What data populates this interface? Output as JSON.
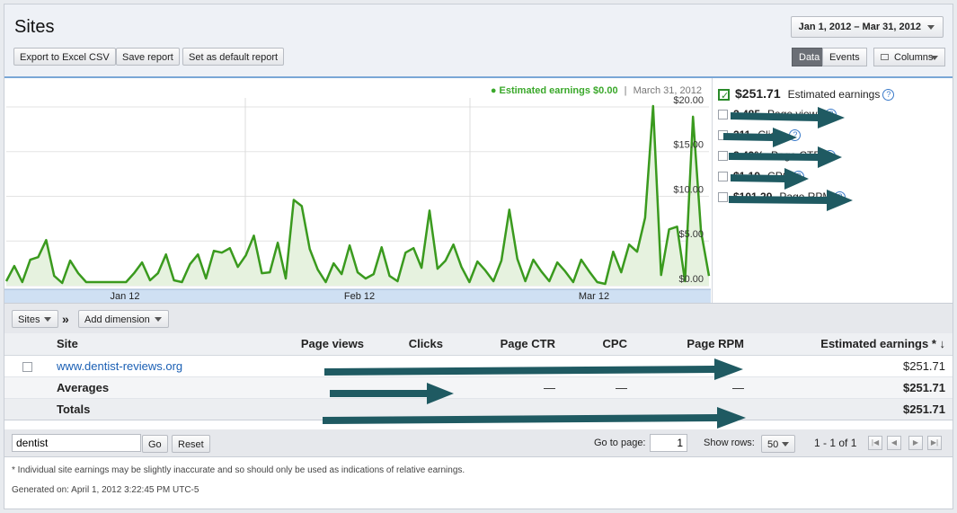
{
  "header": {
    "title": "Sites",
    "date_range": "Jan 1, 2012 – Mar 31, 2012",
    "buttons": {
      "export": "Export to Excel CSV",
      "save": "Save report",
      "default": "Set as default report"
    },
    "view_tabs": {
      "data": "Data",
      "events": "Events",
      "columns": "Columns"
    }
  },
  "chart_legend": {
    "series_label": "● Estimated earnings $0.00",
    "separator": "|",
    "date": "March 31, 2012"
  },
  "chart_data": {
    "type": "line",
    "x_labels": [
      "Jan 12",
      "Feb 12",
      "Mar 12"
    ],
    "y_ticks": [
      "$20.00",
      "$15.00",
      "$10.00",
      "$5.00",
      "$0.00"
    ],
    "ylim": [
      0,
      21
    ],
    "series": [
      {
        "color": "#3a9a1e",
        "values": [
          0.5,
          2.2,
          0.4,
          2.9,
          3.2,
          5.1,
          1.1,
          0.3,
          2.8,
          1.4,
          0.4,
          0.4,
          0.4,
          0.4,
          0.4,
          0.4,
          1.4,
          2.6,
          0.6,
          1.4,
          3.5,
          0.6,
          0.4,
          2.4,
          3.5,
          0.8,
          3.9,
          3.7,
          4.2,
          2.1,
          3.4,
          5.6,
          1.4,
          1.5,
          4.8,
          0.8,
          9.6,
          8.9,
          4.1,
          1.8,
          0.4,
          2.5,
          1.3,
          4.5,
          1.5,
          0.8,
          1.3,
          4.3,
          1.1,
          0.5,
          3.7,
          4.2,
          2.0,
          8.4,
          1.9,
          2.8,
          4.6,
          2.1,
          0.4,
          2.7,
          1.7,
          0.5,
          2.8,
          8.5,
          3.0,
          0.5,
          2.9,
          1.6,
          0.5,
          2.6,
          1.6,
          0.4,
          2.9,
          1.6,
          0.4,
          0.2,
          3.8,
          1.5,
          4.6,
          3.8,
          7.6,
          20.1,
          1.2,
          6.3,
          6.6,
          0.5,
          18.9,
          6.1,
          1.1
        ]
      }
    ],
    "grid": true
  },
  "metrics": [
    {
      "value": "$251.71",
      "label": "Estimated earnings",
      "checked": true
    },
    {
      "value": "2,485",
      "label": "Page views",
      "checked": false
    },
    {
      "value": "211",
      "label": "Clicks",
      "checked": false
    },
    {
      "value": "8.49%",
      "label": "Page CTR",
      "checked": false
    },
    {
      "value": "$1.19",
      "label": "CPC",
      "checked": false
    },
    {
      "value": "$101.29",
      "label": "Page RPM",
      "checked": false
    }
  ],
  "filters": {
    "dimension": "Sites",
    "add_dimension": "Add dimension"
  },
  "table": {
    "headers": [
      "Site",
      "Page views",
      "Clicks",
      "Page CTR",
      "CPC",
      "Page RPM",
      "Estimated earnings * ↓"
    ],
    "row": {
      "site": "www.dentist-reviews.org",
      "earnings": "$251.71"
    },
    "averages": {
      "label": "Averages",
      "ctr": "—",
      "cpc": "—",
      "rpm": "—",
      "earnings": "$251.71"
    },
    "totals": {
      "label": "Totals",
      "earnings": "$251.71"
    }
  },
  "footer": {
    "search_value": "dentist",
    "go": "Go",
    "reset": "Reset",
    "goto_label": "Go to page:",
    "page": "1",
    "rows_label": "Show rows:",
    "rows": "50",
    "range": "1 - 1 of 1"
  },
  "notes": {
    "disclaimer": "* Individual site earnings may be slightly inaccurate and so should only be used as indications of relative earnings.",
    "generated": "Generated on: April 1, 2012 3:22:45 PM UTC-5"
  }
}
